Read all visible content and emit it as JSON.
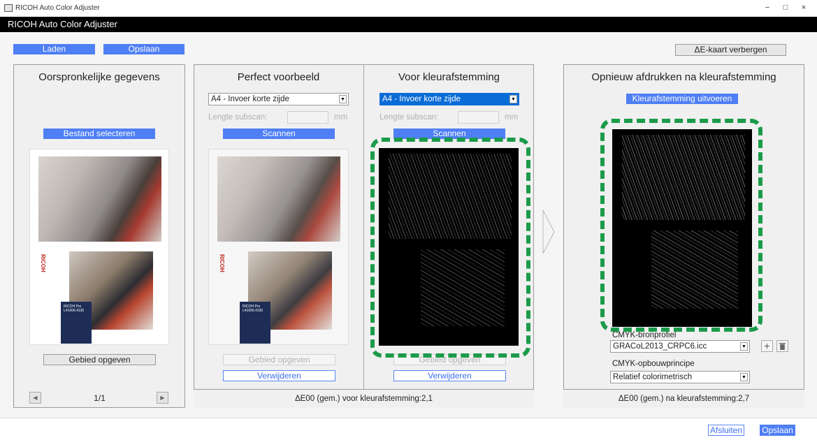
{
  "window": {
    "title": "RICOH Auto Color Adjuster",
    "minimize_glyph": "−",
    "maximize_glyph": "□",
    "close_glyph": "×"
  },
  "app_header": "RICOH Auto Color Adjuster",
  "toolbar": {
    "load_label": "Laden",
    "save_label": "Opslaan",
    "toggle_map_label": "ΔE-kaart verbergen"
  },
  "original": {
    "title": "Oorspronkelijke gegevens",
    "select_file_label": "Bestand selecteren",
    "specify_area_label": "Gebied opgeven",
    "page_indicator": "1/1",
    "prev_glyph": "◀",
    "next_glyph": "▶"
  },
  "perfect": {
    "title": "Perfect voorbeeld",
    "paper_select": "A4 - Invoer korte zijde",
    "subscan_label": "Lengte subscan:",
    "unit": "mm",
    "scan_label": "Scannen",
    "specify_area_label": "Gebied opgeven",
    "delete_label": "Verwijderen"
  },
  "before": {
    "title": "Voor kleurafstemming",
    "paper_select": "A4 - Invoer korte zijde",
    "subscan_label": "Lengte subscan:",
    "unit": "mm",
    "scan_label": "Scannen",
    "specify_area_label": "Gebied opgeven",
    "delete_label": "Verwijderen"
  },
  "middle_status": "ΔE00 (gem.) voor kleurafstemming:2,1",
  "reprint": {
    "title": "Opnieuw afdrukken na kleurafstemming",
    "run_label": "Kleurafstemming uitvoeren",
    "cmyk_profile_label": "CMYK-bronprofiel",
    "cmyk_profile_value": "GRACoL2013_CRPC6.icc",
    "rendering_intent_label": "CMYK-opbouwprincipe",
    "rendering_intent_value": "Relatief colorimetrisch",
    "status": "ΔE00 (gem.) na kleurafstemming:2,7"
  },
  "footer": {
    "close_label": "Afsluiten",
    "save_label": "Opslaan"
  },
  "doc_texts": {
    "brand": "RICOH",
    "card": "RICOH Pro L4160/L4130"
  },
  "colors": {
    "accent_blue": "#4f7ff5",
    "highlight_green": "#1b9b4a",
    "selection_blue": "#0a6cd6"
  }
}
